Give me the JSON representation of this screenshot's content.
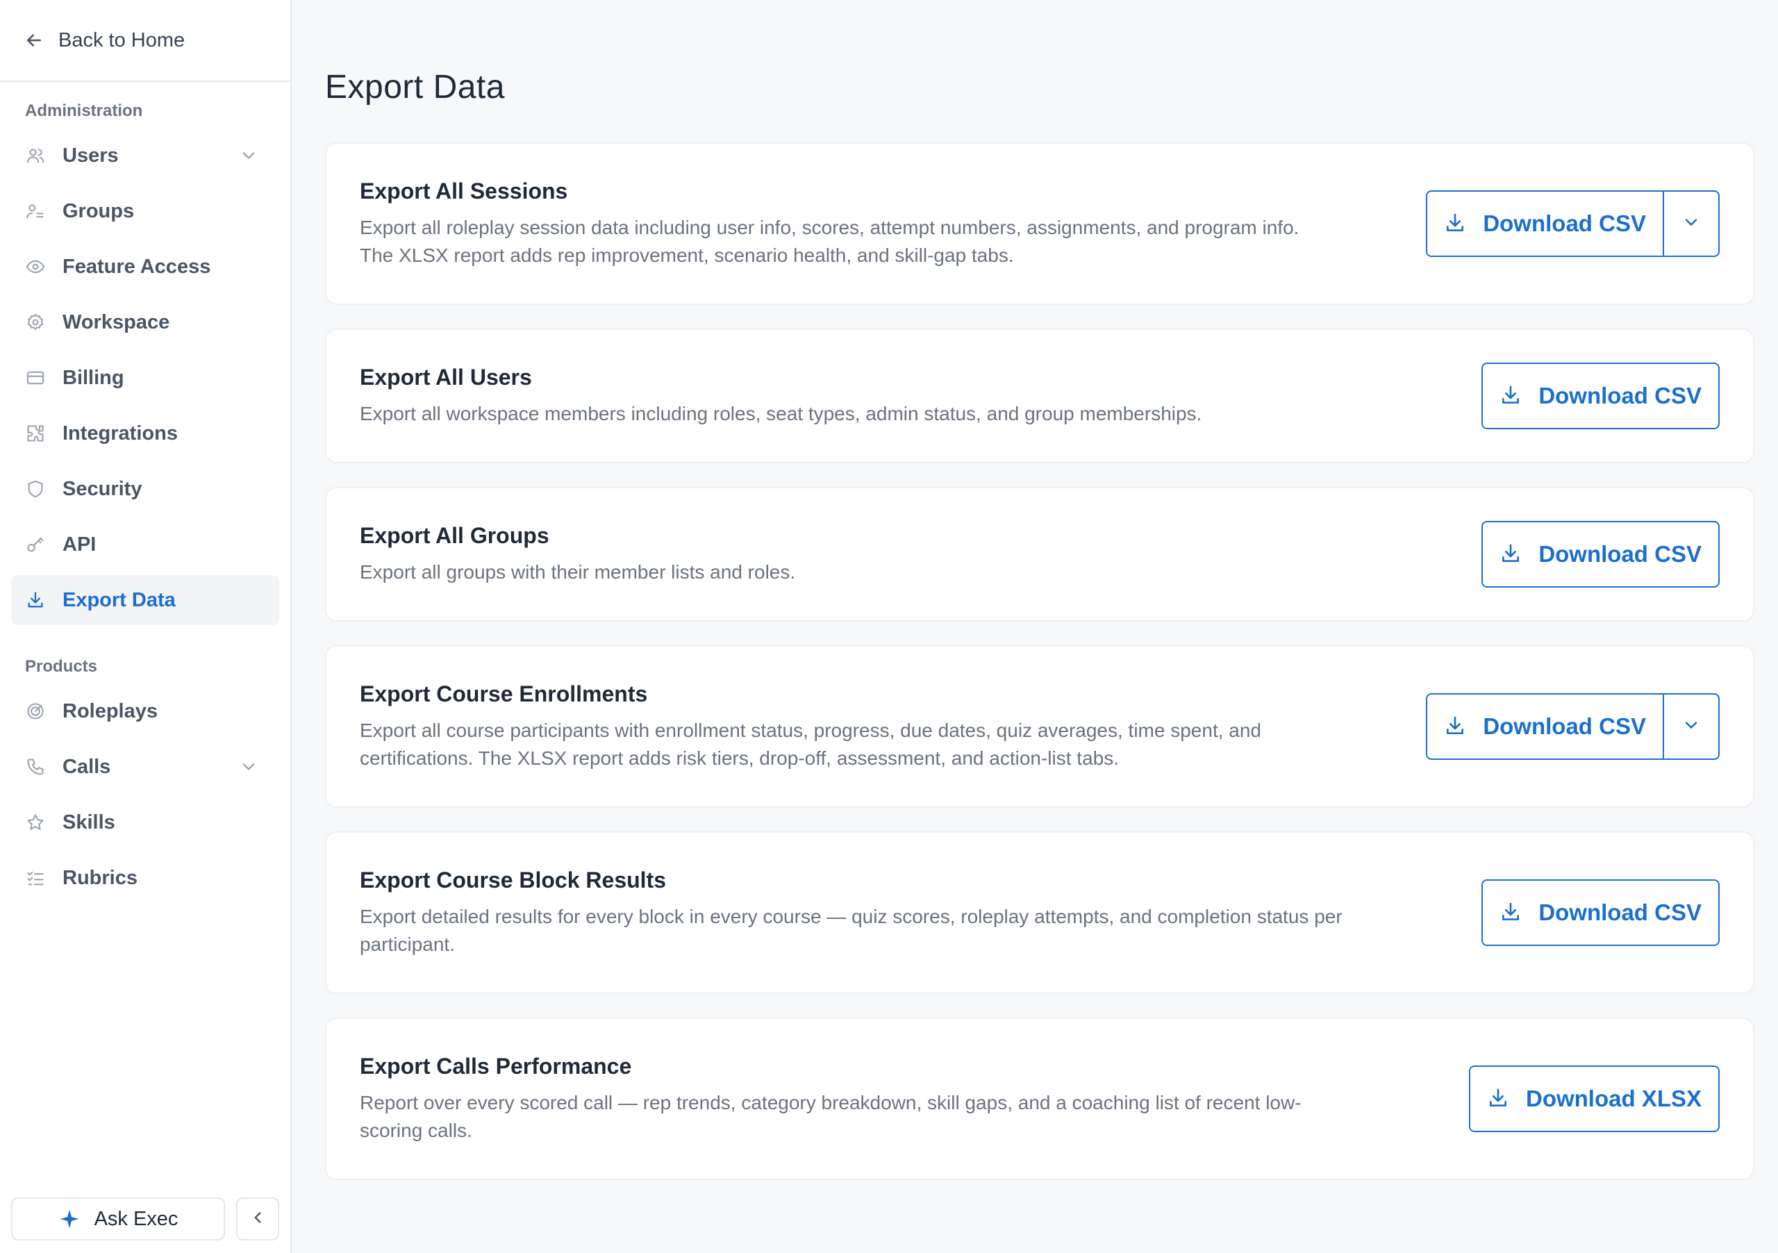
{
  "sidebar": {
    "back_label": "Back to Home",
    "admin_section": "Administration",
    "products_section": "Products",
    "admin_items": [
      {
        "label": "Users",
        "icon": "users-icon"
      },
      {
        "label": "Groups",
        "icon": "groups-icon"
      },
      {
        "label": "Feature Access",
        "icon": "eye-icon"
      },
      {
        "label": "Workspace",
        "icon": "gear-icon"
      },
      {
        "label": "Billing",
        "icon": "credit-card-icon"
      },
      {
        "label": "Integrations",
        "icon": "puzzle-icon"
      },
      {
        "label": "Security",
        "icon": "shield-icon"
      },
      {
        "label": "API",
        "icon": "key-icon"
      },
      {
        "label": "Export Data",
        "icon": "download-icon"
      }
    ],
    "product_items": [
      {
        "label": "Roleplays",
        "icon": "target-icon"
      },
      {
        "label": "Calls",
        "icon": "phone-icon"
      },
      {
        "label": "Skills",
        "icon": "star-icon"
      },
      {
        "label": "Rubrics",
        "icon": "checklist-icon"
      }
    ],
    "ask_label": "Ask Exec"
  },
  "main": {
    "title": "Export Data",
    "cards": [
      {
        "title": "Export All Sessions",
        "desc1": "Export all roleplay session data including user info, scores, attempt numbers, assignments, and program info.",
        "desc2": "The XLSX report adds rep improvement, scenario health, and skill-gap tabs.",
        "button": "Download CSV"
      },
      {
        "title": "Export All Users",
        "desc1": "Export all workspace members including roles, seat types, admin status, and group memberships.",
        "button": "Download CSV"
      },
      {
        "title": "Export All Groups",
        "desc1": "Export all groups with their member lists and roles.",
        "button": "Download CSV"
      },
      {
        "title": "Export Course Enrollments",
        "desc1": "Export all course participants with enrollment status, progress, due dates, quiz averages, time spent, and",
        "desc2": "certifications. The XLSX report adds risk tiers, drop-off, assessment, and action-list tabs.",
        "button": "Download CSV"
      },
      {
        "title": "Export Course Block Results",
        "desc1": "Export detailed results for every block in every course — quiz scores, roleplay attempts, and completion status per",
        "desc2": "participant.",
        "button": "Download CSV"
      },
      {
        "title": "Export Calls Performance",
        "desc1": "Report over every scored call — rep trends, category breakdown, skill gaps, and a coaching list of recent low-",
        "desc2": "scoring calls.",
        "button": "Download XLSX"
      }
    ]
  },
  "colors": {
    "accent": "#1b6fd0",
    "active_bg": "#f3f4f6",
    "page_bg": "#f6f8fa"
  }
}
